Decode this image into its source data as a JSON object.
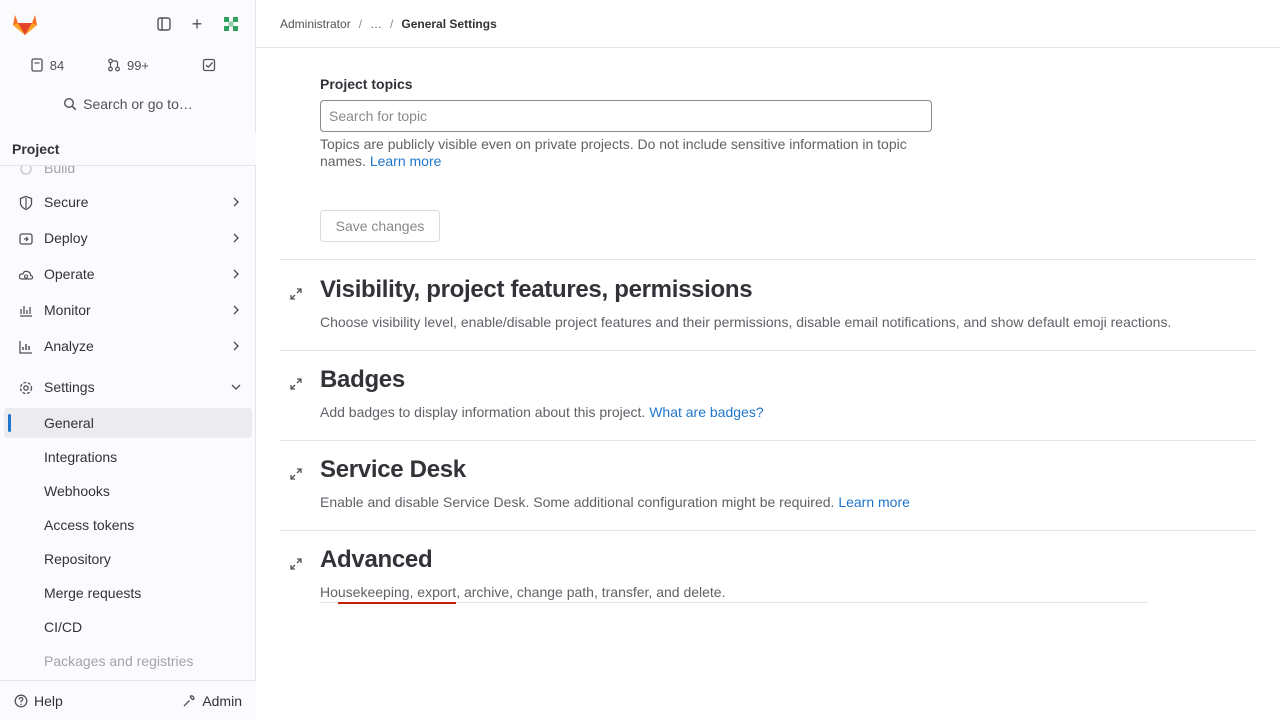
{
  "colors": {
    "accent": "#1f75cb",
    "danger": "#c91c00",
    "logo_orange": "#e24329",
    "logo_light": "#fca326"
  },
  "sidebar": {
    "counters": {
      "issues": "84",
      "merge_requests": "99+"
    },
    "search_label": "Search or go to…",
    "context_title": "Project",
    "items": [
      {
        "label": "Build",
        "icon": "rocket-icon"
      },
      {
        "label": "Secure",
        "icon": "shield-icon"
      },
      {
        "label": "Deploy",
        "icon": "deploy-icon"
      },
      {
        "label": "Operate",
        "icon": "cloud-gear-icon"
      },
      {
        "label": "Monitor",
        "icon": "monitor-icon"
      },
      {
        "label": "Analyze",
        "icon": "chart-icon"
      },
      {
        "label": "Settings",
        "icon": "settings-icon"
      }
    ],
    "settings_sub": [
      "General",
      "Integrations",
      "Webhooks",
      "Access tokens",
      "Repository",
      "Merge requests",
      "CI/CD",
      "Packages and registries"
    ],
    "help_label": "Help",
    "admin_label": "Admin"
  },
  "breadcrumb": {
    "items": [
      "Administrator",
      "…",
      "General Settings"
    ],
    "sep": "/"
  },
  "topics": {
    "label": "Project topics",
    "placeholder": "Search for topic",
    "help_before": "Topics are publicly visible even on private projects. Do not include sensitive information in topic names.",
    "help_link": "Learn more",
    "save_label": "Save changes"
  },
  "sections": [
    {
      "title": "Visibility, project features, permissions",
      "desc": "Choose visibility level, enable/disable project features and their permissions, disable email notifications, and show default emoji reactions.",
      "link": ""
    },
    {
      "title": "Badges",
      "desc": "Add badges to display information about this project.",
      "link": "What are badges?"
    },
    {
      "title": "Service Desk",
      "desc": "Enable and disable Service Desk. Some additional configuration might be required.",
      "link": "Learn more"
    },
    {
      "title": "Advanced",
      "desc": "Housekeeping, export, archive, change path, transfer, and delete.",
      "link": ""
    }
  ]
}
